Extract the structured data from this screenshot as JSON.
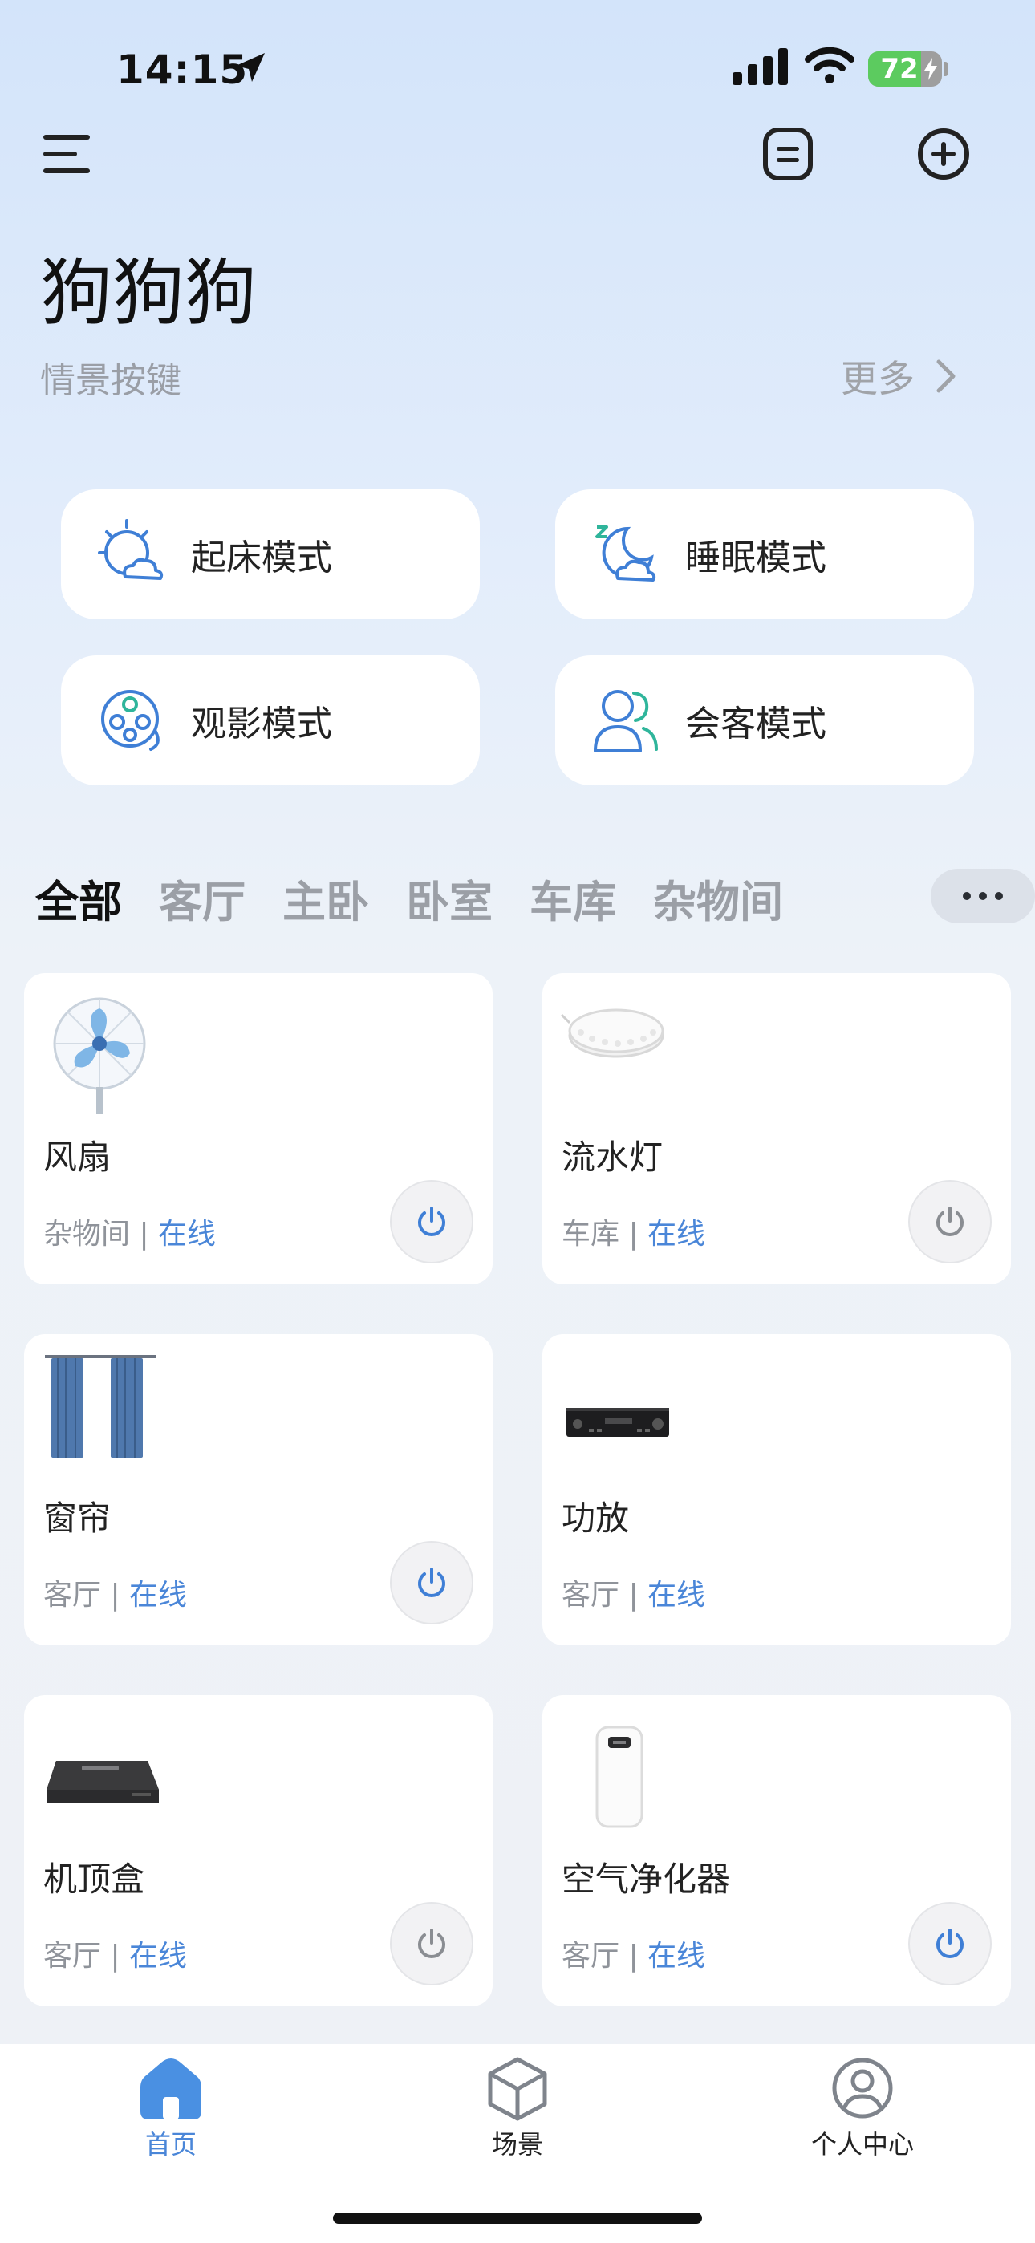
{
  "status_bar": {
    "time": "14:15",
    "battery": "72",
    "battery_level": 0.72
  },
  "header": {
    "title": "狗狗狗",
    "section_label": "情景按键",
    "more_label": "更多"
  },
  "scenes": [
    {
      "label": "起床模式",
      "icon": "sunrise-cloud-icon"
    },
    {
      "label": "睡眠模式",
      "icon": "moon-cloud-icon"
    },
    {
      "label": "观影模式",
      "icon": "film-reel-icon"
    },
    {
      "label": "会客模式",
      "icon": "guests-icon"
    }
  ],
  "room_tabs": [
    "全部",
    "客厅",
    "主卧",
    "卧室",
    "车库",
    "杂物间"
  ],
  "active_tab": "全部",
  "devices": [
    {
      "name": "风扇",
      "room": "杂物间",
      "status": "在线",
      "power_on": true,
      "image": "fan-icon"
    },
    {
      "name": "流水灯",
      "room": "车库",
      "status": "在线",
      "power_on": false,
      "image": "led-strip-icon"
    },
    {
      "name": "窗帘",
      "room": "客厅",
      "status": "在线",
      "power_on": true,
      "image": "curtain-icon"
    },
    {
      "name": "功放",
      "room": "客厅",
      "status": "在线",
      "power_on": null,
      "image": "amplifier-icon"
    },
    {
      "name": "机顶盒",
      "room": "客厅",
      "status": "在线",
      "power_on": false,
      "image": "set-top-box-icon"
    },
    {
      "name": "空气净化器",
      "room": "客厅",
      "status": "在线",
      "power_on": true,
      "image": "air-purifier-icon"
    }
  ],
  "bottom_nav": [
    {
      "label": "首页",
      "icon": "home-icon",
      "active": true
    },
    {
      "label": "场景",
      "icon": "cube-icon",
      "active": false
    },
    {
      "label": "个人中心",
      "icon": "user-icon",
      "active": false
    }
  ],
  "colors": {
    "accent": "#4a86d8",
    "battery": "#5ccb5f"
  }
}
